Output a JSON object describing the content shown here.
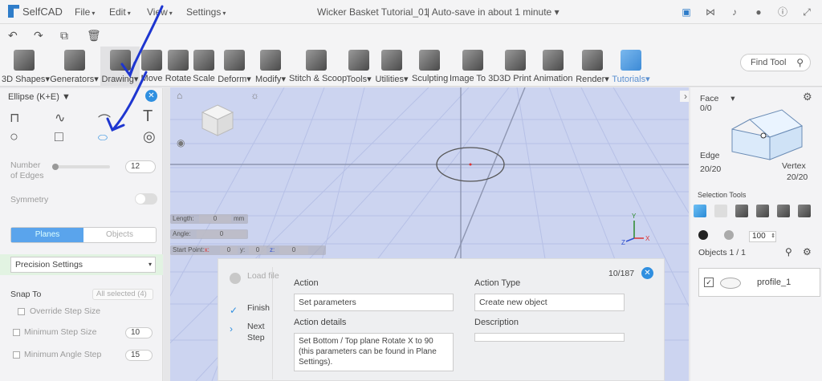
{
  "app": {
    "logo": "SelfCAD",
    "doc_title": "Wicker Basket Tutorial_01",
    "autosave": "Auto-save in about 1 minute"
  },
  "menu": [
    "File",
    "Edit",
    "View",
    "Settings"
  ],
  "toolbar": {
    "items": [
      "3D Shapes",
      "Generators",
      "Drawing",
      "Move",
      "Rotate",
      "Scale",
      "Deform",
      "Modify",
      "Stitch & Scoop",
      "Tools",
      "Utilities",
      "Sculpting",
      "Image To 3D",
      "3D Print",
      "Animation",
      "Render",
      "Tutorials"
    ],
    "find_tool": "Find Tool"
  },
  "left_panel": {
    "title": "Ellipse (K+E)",
    "text_tool_glyph": "T",
    "number_of_edges_label": "Number of Edges",
    "edges_value": "12",
    "symmetry_label": "Symmetry",
    "seg_planes": "Planes",
    "seg_objects": "Objects",
    "precision": "Precision Settings",
    "snap_to_label": "Snap To",
    "snap_to_value": "All selected (4)",
    "override_step_size": "Override Step Size",
    "minimum_step_size": "Minimum Step Size",
    "minimum_step_size_value": "10",
    "minimum_angle_step": "Minimum Angle Step",
    "minimum_angle_step_value": "15"
  },
  "viewport": {
    "length_label": "Length:",
    "length_value": "0",
    "length_unit": "mm",
    "angle_label": "Angle:",
    "angle_value": "0",
    "start_point_label": "Start Point:",
    "sp_x_label": "x:",
    "sp_x": "0",
    "sp_y_label": "y:",
    "sp_y": "0",
    "sp_z_label": "z:",
    "sp_z": "0",
    "axis_x": "X",
    "axis_y": "Y",
    "axis_z": "Z",
    "grid_color": "#ccd4f0"
  },
  "tutorial": {
    "counter": "10/187",
    "step_load": "Load file",
    "step_finish": "Finish",
    "step_next": "Next Step",
    "action_label": "Action",
    "action_value": "Set parameters",
    "action_type_label": "Action Type",
    "action_type_value": "Create new object",
    "action_details_label": "Action details",
    "action_details_value": "Set Bottom / Top plane Rotate X to 90 (this parameters can be found in Plane Settings).",
    "description_label": "Description"
  },
  "right_panel": {
    "face_label": "Face",
    "face_count": "0/0",
    "edge_label": "Edge",
    "edge_count": "20/20",
    "vertex_label": "Vertex",
    "vertex_count": "20/20",
    "selection_tools": "Selection Tools",
    "brush_size": "100",
    "objects_label": "Objects 1 / 1",
    "object_name": "profile_1"
  }
}
